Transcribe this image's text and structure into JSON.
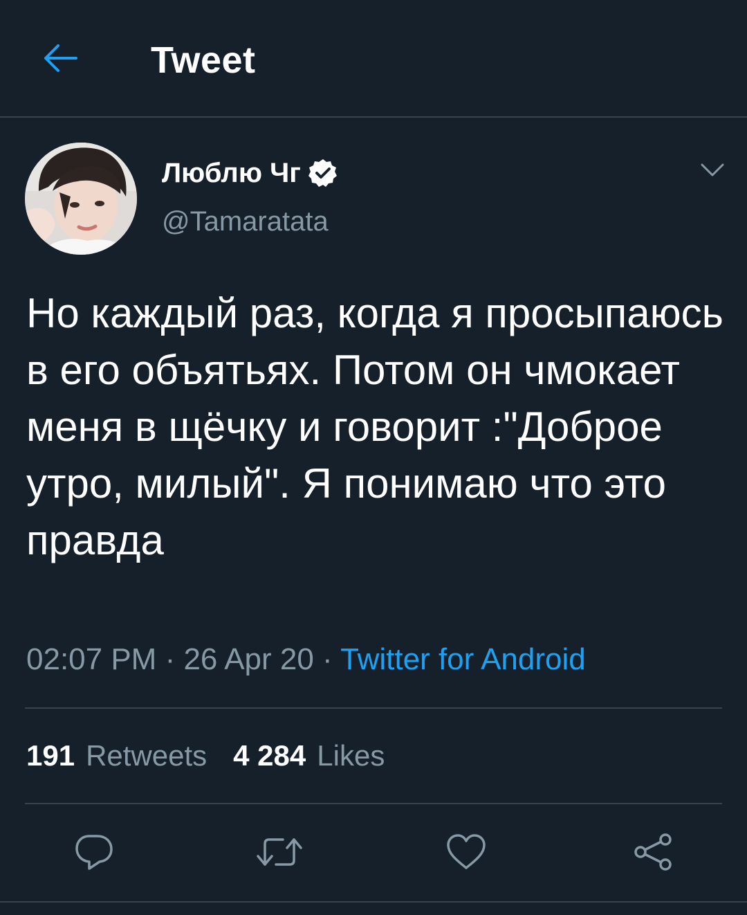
{
  "header": {
    "title": "Tweet",
    "back_icon": "arrow-left-icon",
    "accent_color": "#1da1f2"
  },
  "author": {
    "name": "Люблю Чг",
    "handle": "@Tamaratata",
    "verified": true
  },
  "tweet": {
    "text": "Но каждый раз, когда я просыпаюсь в его объятьях. Потом он чмокает меня в щёчку и говорит :\"Доброе утро, милый\". Я понимаю что это правда",
    "time": "02:07 PM",
    "separator": " · ",
    "date": "26 Apr 20",
    "source": "Twitter for Android"
  },
  "stats": {
    "retweets_count": "191",
    "retweets_label": "Retweets",
    "likes_count": "4 284",
    "likes_label": "Likes"
  },
  "actions": [
    "reply-icon",
    "retweet-icon",
    "like-icon",
    "share-icon"
  ],
  "colors": {
    "background": "#15202b",
    "secondary_text": "#8899a6",
    "divider": "#38444d",
    "link": "#1da1f2"
  }
}
